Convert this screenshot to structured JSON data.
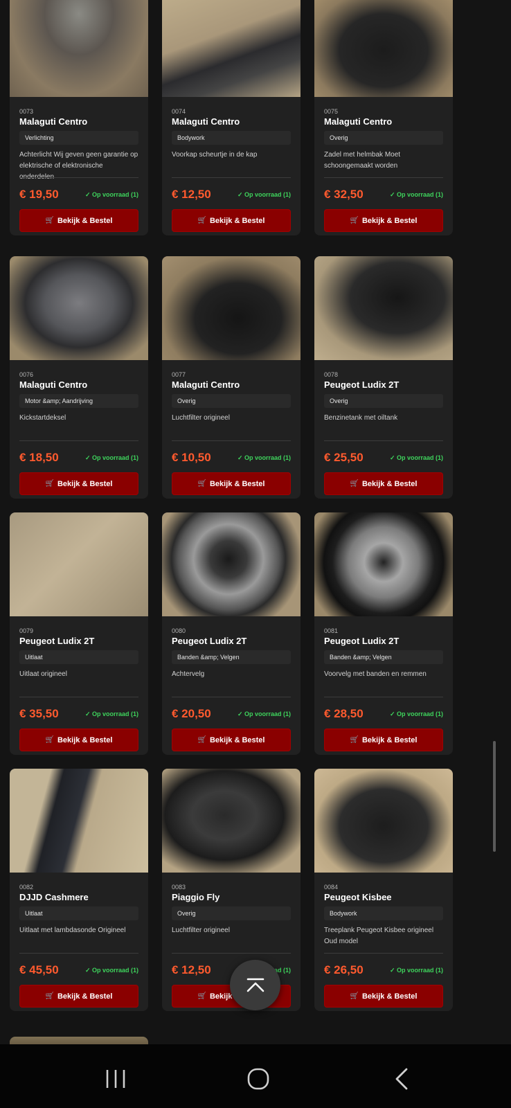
{
  "products": [
    {
      "sku": "0073",
      "title": "Malaguti Centro",
      "category": "Verlichting",
      "description": "Achterlicht Wij geven geen garantie op elektrische of elektronische onderdelen",
      "price": "€ 19,50",
      "stock": "✓ Op voorraad (1)",
      "button": "Bekijk & Bestel"
    },
    {
      "sku": "0074",
      "title": "Malaguti Centro",
      "category": "Bodywork",
      "description": "Voorkap scheurtje in de kap",
      "price": "€ 12,50",
      "stock": "✓ Op voorraad (1)",
      "button": "Bekijk & Bestel"
    },
    {
      "sku": "0075",
      "title": "Malaguti Centro",
      "category": "Overig",
      "description": "Zadel met helmbak Moet schoongemaakt worden",
      "price": "€ 32,50",
      "stock": "✓ Op voorraad (1)",
      "button": "Bekijk & Bestel"
    },
    {
      "sku": "0076",
      "title": "Malaguti Centro",
      "category": "Motor &amp; Aandrijving",
      "description": "Kickstartdeksel",
      "price": "€ 18,50",
      "stock": "✓ Op voorraad (1)",
      "button": "Bekijk & Bestel"
    },
    {
      "sku": "0077",
      "title": "Malaguti Centro",
      "category": "Overig",
      "description": "Luchtfilter origineel",
      "price": "€ 10,50",
      "stock": "✓ Op voorraad (1)",
      "button": "Bekijk & Bestel"
    },
    {
      "sku": "0078",
      "title": "Peugeot Ludix 2T",
      "category": "Overig",
      "description": "Benzinetank met oiltank",
      "price": "€ 25,50",
      "stock": "✓ Op voorraad (1)",
      "button": "Bekijk & Bestel"
    },
    {
      "sku": "0079",
      "title": "Peugeot Ludix 2T",
      "category": "Uitlaat",
      "description": "Uitlaat origineel",
      "price": "€ 35,50",
      "stock": "✓ Op voorraad (1)",
      "button": "Bekijk & Bestel"
    },
    {
      "sku": "0080",
      "title": "Peugeot Ludix 2T",
      "category": "Banden &amp; Velgen",
      "description": "Achtervelg",
      "price": "€ 20,50",
      "stock": "✓ Op voorraad (1)",
      "button": "Bekijk & Bestel"
    },
    {
      "sku": "0081",
      "title": "Peugeot Ludix 2T",
      "category": "Banden &amp; Velgen",
      "description": "Voorvelg met banden en remmen",
      "price": "€ 28,50",
      "stock": "✓ Op voorraad (1)",
      "button": "Bekijk & Bestel"
    },
    {
      "sku": "0082",
      "title": "DJJD Cashmere",
      "category": "Uitlaat",
      "description": "Uitlaat met lambdasonde Origineel",
      "price": "€ 45,50",
      "stock": "✓ Op voorraad (1)",
      "button": "Bekijk & Bestel"
    },
    {
      "sku": "0083",
      "title": "Piaggio Fly",
      "category": "Overig",
      "description": "Luchtfilter origineel",
      "price": "€ 12,50",
      "stock": "✓ Op voorraad (1)",
      "button": "Bekijk & Bestel"
    },
    {
      "sku": "0084",
      "title": "Peugeot Kisbee",
      "category": "Bodywork",
      "description": "Treeplank Peugeot Kisbee origineel Oud model",
      "price": "€ 26,50",
      "stock": "✓ Op voorraad (1)",
      "button": "Bekijk & Bestel"
    }
  ],
  "icons": {
    "cart": "cart-icon",
    "scroll_top": "chevron-up-icon",
    "nav_recents": "recents-icon",
    "nav_home": "home-icon",
    "nav_back": "back-icon"
  },
  "colors": {
    "accent": "#8a0000",
    "price": "#ff5a2e",
    "stock": "#3ed35c",
    "background": "#141414",
    "card": "#212121"
  }
}
